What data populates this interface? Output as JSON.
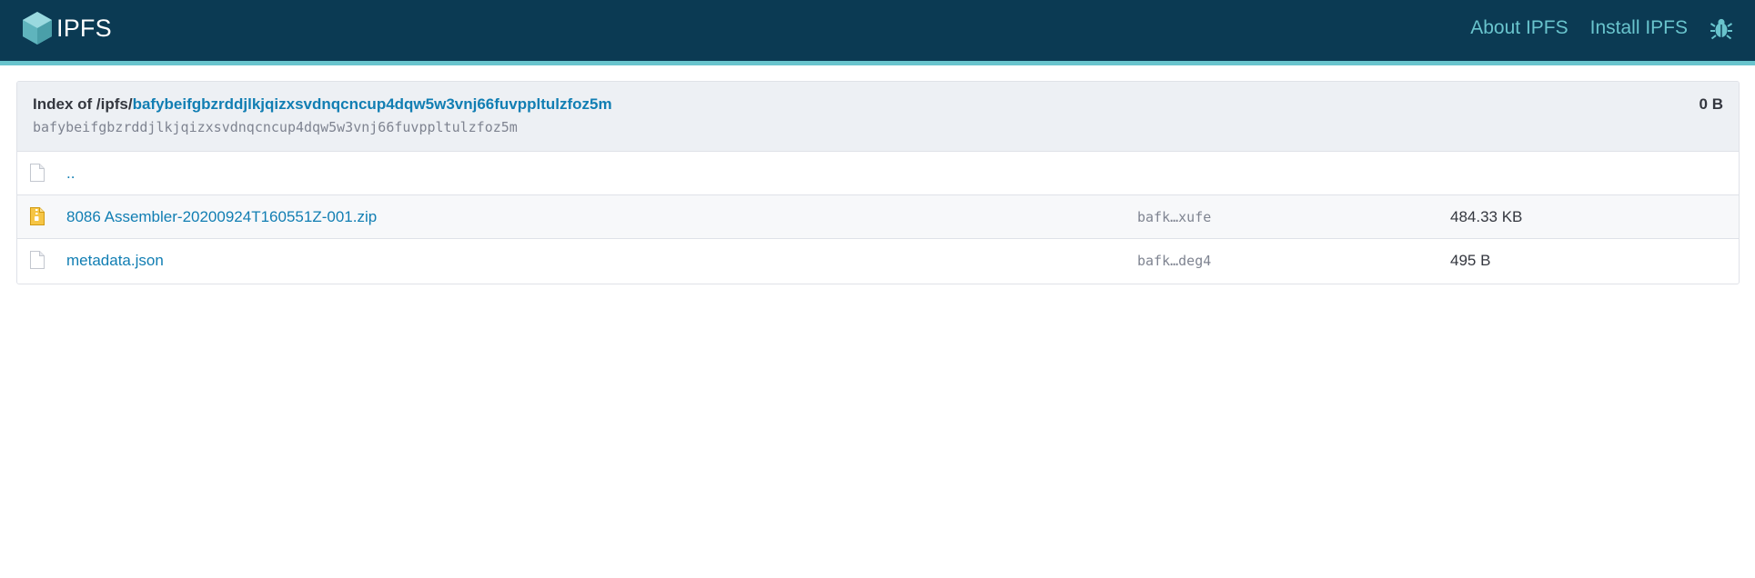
{
  "header": {
    "logo_text": "IPFS",
    "nav": [
      {
        "label": "About IPFS"
      },
      {
        "label": "Install IPFS"
      }
    ],
    "bug_icon": "bug-icon"
  },
  "index": {
    "prefix": "Index of /ipfs/",
    "cid_link": "bafybeifgbzrddjlkjqizxsvdnqcncup4dqw5w3vnj66fuvppltulzfoz5m",
    "cid_mono": "bafybeifgbzrddjlkjqizxsvdnqcncup4dqw5w3vnj66fuvppltulzfoz5m",
    "total_size": "0 B"
  },
  "entries": [
    {
      "name": "..",
      "cid": "",
      "size": "",
      "icon": "file-icon"
    },
    {
      "name": "8086 Assembler-20200924T160551Z-001.zip",
      "cid": "bafk…xufe",
      "size": "484.33 KB",
      "icon": "zip-file-icon"
    },
    {
      "name": "metadata.json",
      "cid": "bafk…deg4",
      "size": "495 B",
      "icon": "file-icon"
    }
  ],
  "colors": {
    "topbar": "#0b3a53",
    "accent": "#69c4cd",
    "link": "#117eb3"
  }
}
